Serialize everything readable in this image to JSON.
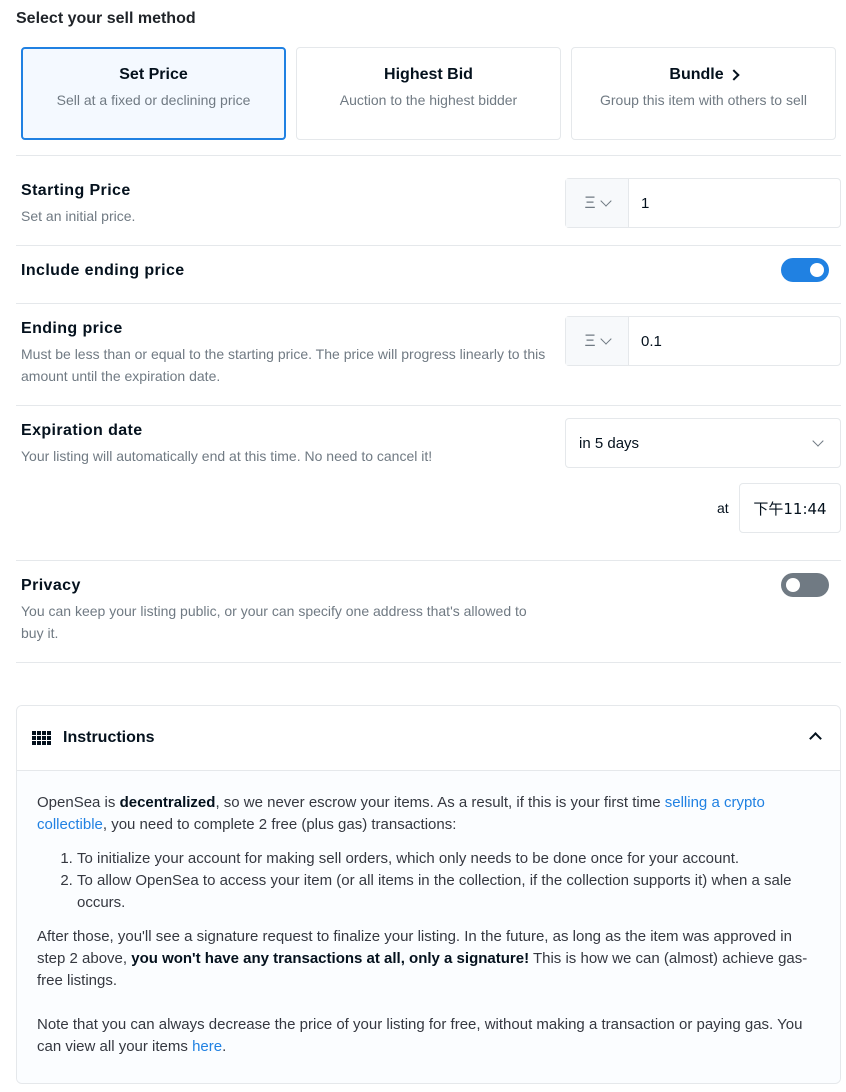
{
  "header": {
    "title": "Select your sell method"
  },
  "methods": [
    {
      "title": "Set Price",
      "subtitle": "Sell at a fixed or declining price",
      "selected": true
    },
    {
      "title": "Highest Bid",
      "subtitle": "Auction to the highest bidder",
      "selected": false
    },
    {
      "title": "Bundle",
      "subtitle": "Group this item with others to sell",
      "selected": false
    }
  ],
  "starting_price": {
    "title": "Starting Price",
    "subtitle": "Set an initial price.",
    "currency": "Ξ",
    "value": "1"
  },
  "include_ending": {
    "title": "Include ending price",
    "enabled": true
  },
  "ending_price": {
    "title": "Ending price",
    "subtitle": "Must be less than or equal to the starting price. The price will progress linearly to this amount until the expiration date.",
    "currency": "Ξ",
    "value": "0.1"
  },
  "expiration": {
    "title": "Expiration date",
    "subtitle": "Your listing will automatically end at this time. No need to cancel it!",
    "selected": "in 5 days",
    "at_label": "at",
    "time": "下午11:44"
  },
  "privacy": {
    "title": "Privacy",
    "subtitle": "You can keep your listing public, or your can specify one address that's allowed to buy it.",
    "enabled": false
  },
  "instructions": {
    "title": "Instructions",
    "p1_a": "OpenSea is ",
    "p1_b": "decentralized",
    "p1_c": ", so we never escrow your items. As a result, if this is your first time ",
    "p1_link": "selling a crypto collectible",
    "p1_d": ", you need to complete 2 free (plus gas) transactions:",
    "steps": [
      "To initialize your account for making sell orders, which only needs to be done once for your account.",
      "To allow OpenSea to access your item (or all items in the collection, if the collection supports it) when a sale occurs."
    ],
    "p2_a": "After those, you'll see a signature request to finalize your listing. In the future, as long as the item was approved in step 2 above, ",
    "p2_b": "you won't have any transactions at all, only a signature!",
    "p2_c": " This is how we can (almost) achieve gas-free listings.",
    "p3_a": "Note that you can always decrease the price of your listing for free, without making a transaction or paying gas. You can view all your items ",
    "p3_link": "here",
    "p3_b": "."
  },
  "colors": {
    "accent": "#2081e2",
    "toggle_off": "#707a83",
    "border": "#e5e8eb",
    "muted_text": "#707a83"
  }
}
